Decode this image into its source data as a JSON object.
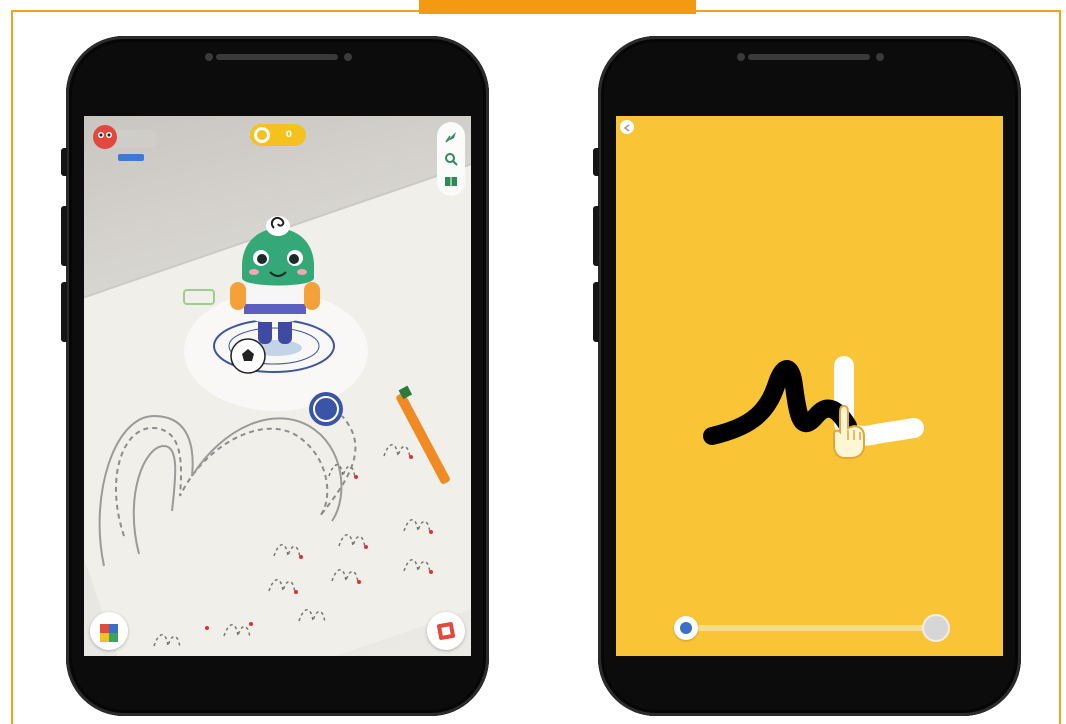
{
  "banner": {
    "title": ""
  },
  "left_phone": {
    "profile": {
      "name": "",
      "badge": ""
    },
    "coins": {
      "value": "0"
    },
    "tools": [
      "leaf-icon",
      "search-icon",
      "book-icon"
    ],
    "bottom_left_button": "blocks-icon",
    "bottom_right_button": "card-icon",
    "mascot_ball_letter": "@"
  },
  "right_phone": {
    "slider": {
      "progress": 0.0
    }
  },
  "colors": {
    "frame": "#f0a21a",
    "screen_yellow": "#f9c435",
    "accent_blue": "#3b6fc6",
    "mascot_green": "#35a877"
  }
}
